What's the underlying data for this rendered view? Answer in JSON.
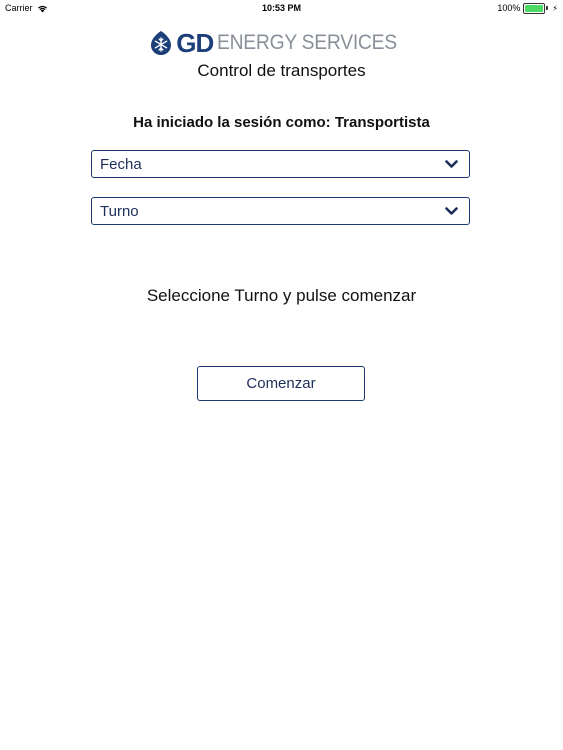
{
  "status_bar": {
    "carrier": "Carrier",
    "time": "10:53 PM",
    "battery": "100%",
    "battery_level": 1.0,
    "battery_color": "#4cd964"
  },
  "logo": {
    "brand": "GD",
    "rest": "ENERGY SERVICES",
    "brand_color": "#1c3f7a",
    "rest_color": "#8a9099"
  },
  "app": {
    "title": "Control de transportes"
  },
  "session": {
    "label": "Ha iniciado la sesión como: Transportista"
  },
  "form": {
    "date_select": {
      "value": "Fecha",
      "icon": "chevron-down-icon"
    },
    "shift_select": {
      "value": "Turno",
      "icon": "chevron-down-icon"
    }
  },
  "instruction": "Seleccione Turno y pulse comenzar",
  "start_button": {
    "label": "Comenzar"
  },
  "colors": {
    "accent": "#1c3a6e"
  }
}
